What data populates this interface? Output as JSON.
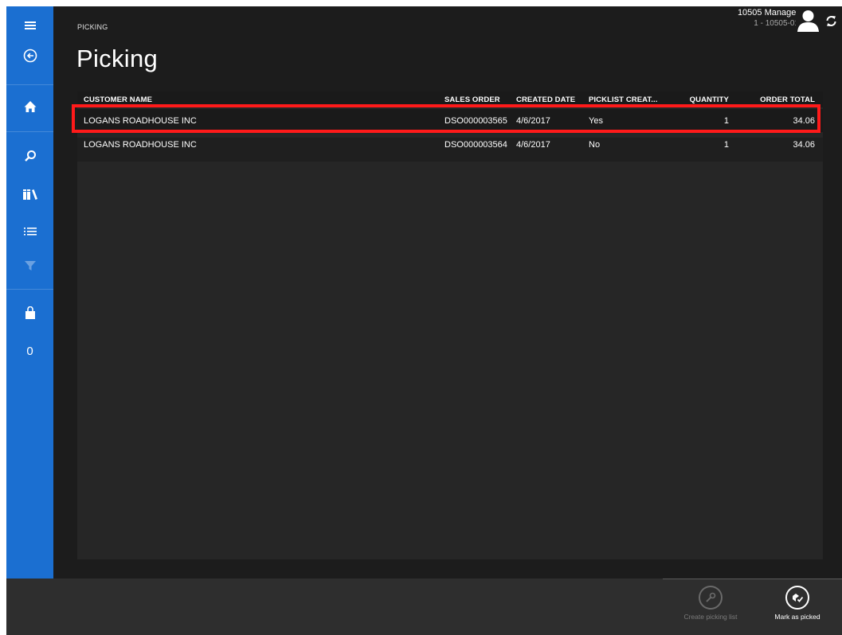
{
  "header": {
    "breadcrumb": "PICKING",
    "title": "Picking",
    "user_name": "10505 Manager",
    "user_store": "1 - 10505-01"
  },
  "nav": {
    "items": [
      {
        "icon": "hamburger-menu-icon"
      },
      {
        "icon": "back-arrow-icon"
      },
      {
        "icon": "home-icon"
      },
      {
        "icon": "search-icon"
      },
      {
        "icon": "products-icon"
      },
      {
        "icon": "list-icon"
      },
      {
        "icon": "filter-icon",
        "disabled": true
      },
      {
        "icon": "shopping-bag-icon"
      }
    ],
    "cart_count": "0"
  },
  "grid": {
    "columns": [
      "CUSTOMER NAME",
      "SALES ORDER",
      "CREATED DATE",
      "PICKLIST CREAT...",
      "QUANTITY",
      "ORDER TOTAL"
    ],
    "rows": [
      [
        "LOGANS ROADHOUSE INC",
        "DSO000003565",
        "4/6/2017",
        "Yes",
        "1",
        "34.06"
      ],
      [
        "LOGANS ROADHOUSE INC",
        "DSO000003564",
        "4/6/2017",
        "No",
        "1",
        "34.06"
      ]
    ],
    "selected_row": 0
  },
  "appbar": {
    "create_picking_list": "Create picking list",
    "mark_as_picked": "Mark as picked"
  },
  "colors": {
    "nav_blue": "#1b6fd1",
    "background": "#1c1c1c",
    "highlight": "#ff1a1a"
  }
}
